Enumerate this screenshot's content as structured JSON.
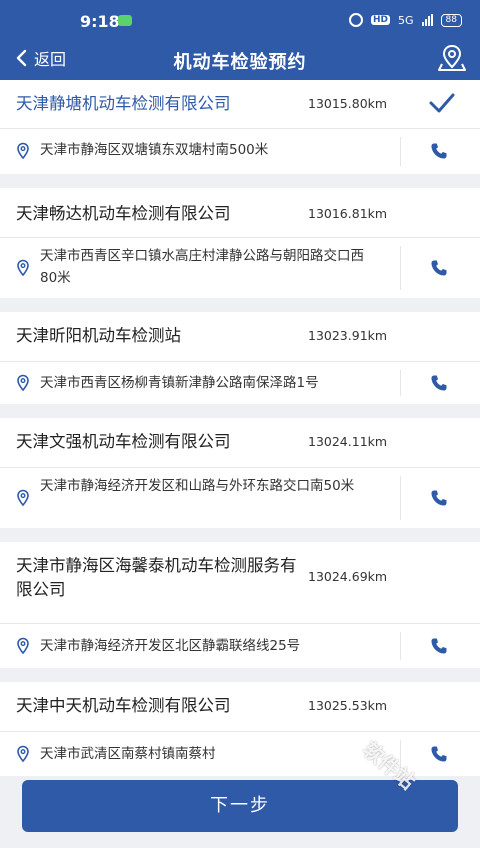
{
  "status": {
    "time": "9:18",
    "network": "5G",
    "battery": "88"
  },
  "header": {
    "back_label": "返回",
    "title": "机动车检验预约"
  },
  "stations": [
    {
      "name": "天津静塘机动车检测有限公司",
      "distance": "13015.80km",
      "address": "天津市静海区双塘镇东双塘村南500米",
      "selected": true
    },
    {
      "name": "天津畅达机动车检测有限公司",
      "distance": "13016.81km",
      "address": "天津市西青区辛口镇水高庄村津静公路与朝阳路交口西80米",
      "selected": false
    },
    {
      "name": "天津昕阳机动车检测站",
      "distance": "13023.91km",
      "address": "天津市西青区杨柳青镇新津静公路南保泽路1号",
      "selected": false
    },
    {
      "name": "天津文强机动车检测有限公司",
      "distance": "13024.11km",
      "address": "天津市静海经济开发区和山路与外环东路交口南50米",
      "selected": false
    },
    {
      "name": "天津市静海区海馨泰机动车检测服务有限公司",
      "distance": "13024.69km",
      "address": "天津市静海经济开发区北区静霸联络线25号",
      "selected": false
    },
    {
      "name": "天津中天机动车检测有限公司",
      "distance": "13025.53km",
      "address": "天津市武清区南蔡村镇南蔡村",
      "selected": false
    }
  ],
  "footer": {
    "next_label": "下一步"
  },
  "watermark": "软件站",
  "colors": {
    "primary": "#2f5aa8",
    "background": "#eef0f4"
  }
}
